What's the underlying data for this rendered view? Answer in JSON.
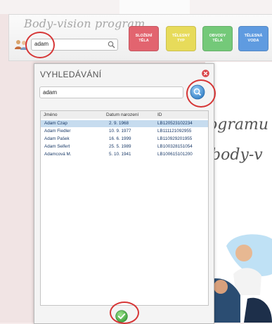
{
  "app": {
    "title": "Body-vision program",
    "search_value": "adam",
    "tiles": [
      {
        "label": "SLOŽENÍ\nTĚLA",
        "color": "#e2646f"
      },
      {
        "label": "TĚLESNÝ\nTYP",
        "color": "#e7db5a"
      },
      {
        "label": "OBVODY\nTĚLA",
        "color": "#74c979"
      },
      {
        "label": "TĚLESNÁ\nVODA",
        "color": "#5f9be0"
      }
    ],
    "script_line1": "ogramu",
    "script_line2": "body-v"
  },
  "dialog": {
    "title": "VYHLEDÁVÁNÍ",
    "search_value": "adam",
    "columns": {
      "name": "Jméno",
      "birth": "Datum narození",
      "id": "ID"
    },
    "rows": [
      {
        "name": "Adam Czap",
        "birth": "2. 9. 1968",
        "id": "LB120523102234"
      },
      {
        "name": "Adam Fiedler",
        "birth": "10. 9. 1977",
        "id": "LB111121092955"
      },
      {
        "name": "Adam Pašek",
        "birth": "16. 6. 1999",
        "id": "LB110929201955"
      },
      {
        "name": "Adam Seifert",
        "birth": "25. 5. 1989",
        "id": "LB100328151054"
      },
      {
        "name": "Adamcová M.",
        "birth": "5. 10. 1941",
        "id": "LB100615101200"
      }
    ],
    "selected_row": 0
  },
  "icons": {
    "search_icon": "magnifier",
    "users_icon": "two-people",
    "close_icon": "red-x",
    "dialog_search_icon": "blue-magnifier-button",
    "ok_icon": "green-checkmark-button"
  },
  "colors": {
    "highlight": "#d63636",
    "selected_row": "#c6dcef",
    "ok_green": "#48b648",
    "search_blue": "#3b8fd6"
  }
}
